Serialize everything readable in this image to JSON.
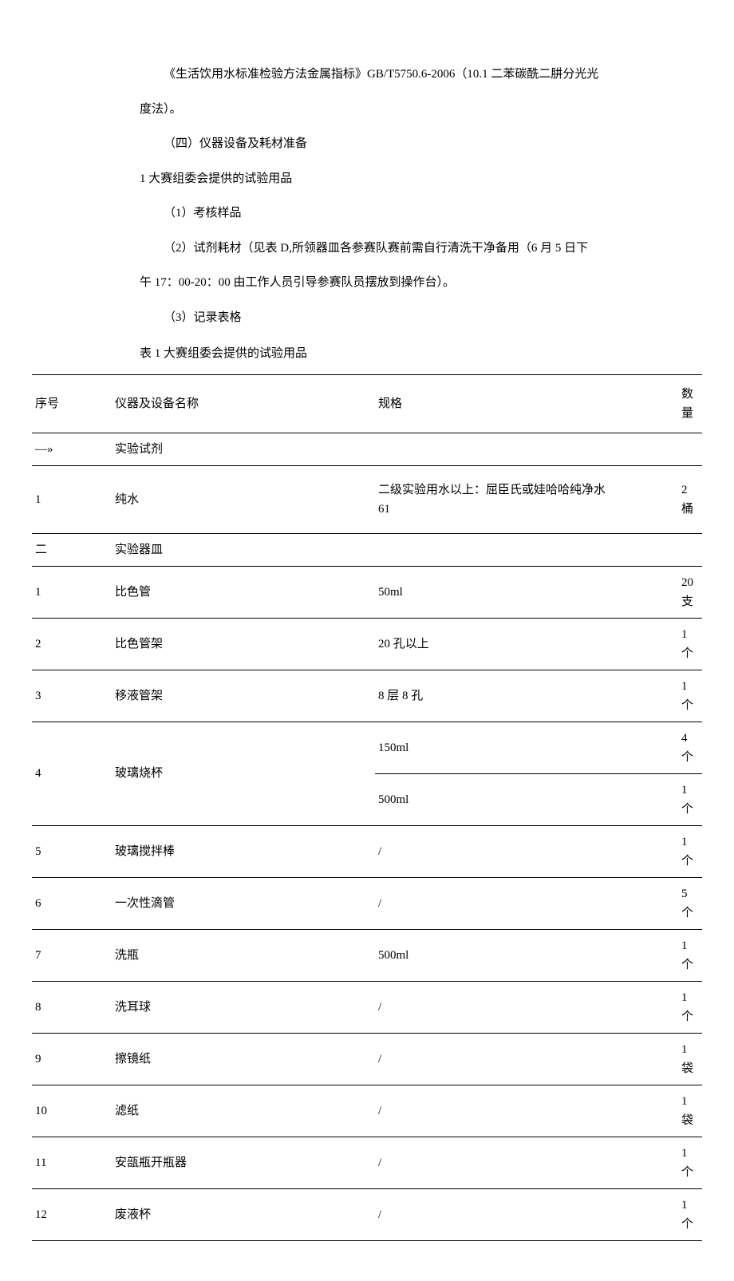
{
  "paragraphs": {
    "p1": "《生活饮用水标准检验方法金属指标》GB/T5750.6-2006（10.1 二苯碳酰二肼分光光",
    "p2": "度法）。",
    "p3": "（四）仪器设备及耗材准备",
    "p4": "1 大赛组委会提供的试验用品",
    "p5": "（1）考核样品",
    "p6": "（2）试剂耗材（见表 D,所领器皿各参赛队赛前需自行清洗干净备用（6 月 5 日下",
    "p7": "午 17：00-20：00 由工作人员引导参赛队员摆放到操作台）。",
    "p8": "（3）记录表格",
    "caption": "表 1 大赛组委会提供的试验用品"
  },
  "table": {
    "headers": {
      "c1": "序号",
      "c2": "仪器及设备名称",
      "c3": "规格",
      "c4": "数量"
    },
    "rows": [
      {
        "c1": "—»",
        "c2": "实验试剂",
        "c3": "",
        "c4": ""
      },
      {
        "c1": "1",
        "c2": "纯水",
        "c3": "二级实验用水以上：屈臣氏或娃哈哈纯净水61",
        "c4": "2 桶",
        "tall": true,
        "multiline": true
      },
      {
        "c1": "二",
        "c2": "实验器皿",
        "c3": "",
        "c4": ""
      },
      {
        "c1": "1",
        "c2": "比色管",
        "c3": "50ml",
        "c4": "20 支"
      },
      {
        "c1": "2",
        "c2": "比色管架",
        "c3": "20 孔以上",
        "c4": "1 个"
      },
      {
        "c1": "3",
        "c2": "移液管架",
        "c3": "8 层 8 孔",
        "c4": "1 个"
      },
      {
        "c1": "4",
        "c2": "玻璃烧杯",
        "c3": "150ml",
        "c4": "4 个",
        "rowspan": 2
      },
      {
        "c1": "",
        "c2": "",
        "c3": "500ml",
        "c4": "1 个",
        "continuation": true
      },
      {
        "c1": "5",
        "c2": "玻璃搅拌棒",
        "c3": "/",
        "c4": "1 个"
      },
      {
        "c1": "6",
        "c2": "一次性滴管",
        "c3": "/",
        "c4": "5 个"
      },
      {
        "c1": "7",
        "c2": "洗瓶",
        "c3": "500ml",
        "c4": "1 个"
      },
      {
        "c1": "8",
        "c2": "洗耳球",
        "c3": "/",
        "c4": "1 个"
      },
      {
        "c1": "9",
        "c2": "擦镜纸",
        "c3": "/",
        "c4": "1 袋"
      },
      {
        "c1": "10",
        "c2": "滤纸",
        "c3": "/",
        "c4": "1 袋"
      },
      {
        "c1": "11",
        "c2": "安瓿瓶开瓶器",
        "c3": "/",
        "c4": "1 个"
      },
      {
        "c1": "12",
        "c2": "废液杯",
        "c3": "/",
        "c4": "1 个"
      }
    ]
  }
}
